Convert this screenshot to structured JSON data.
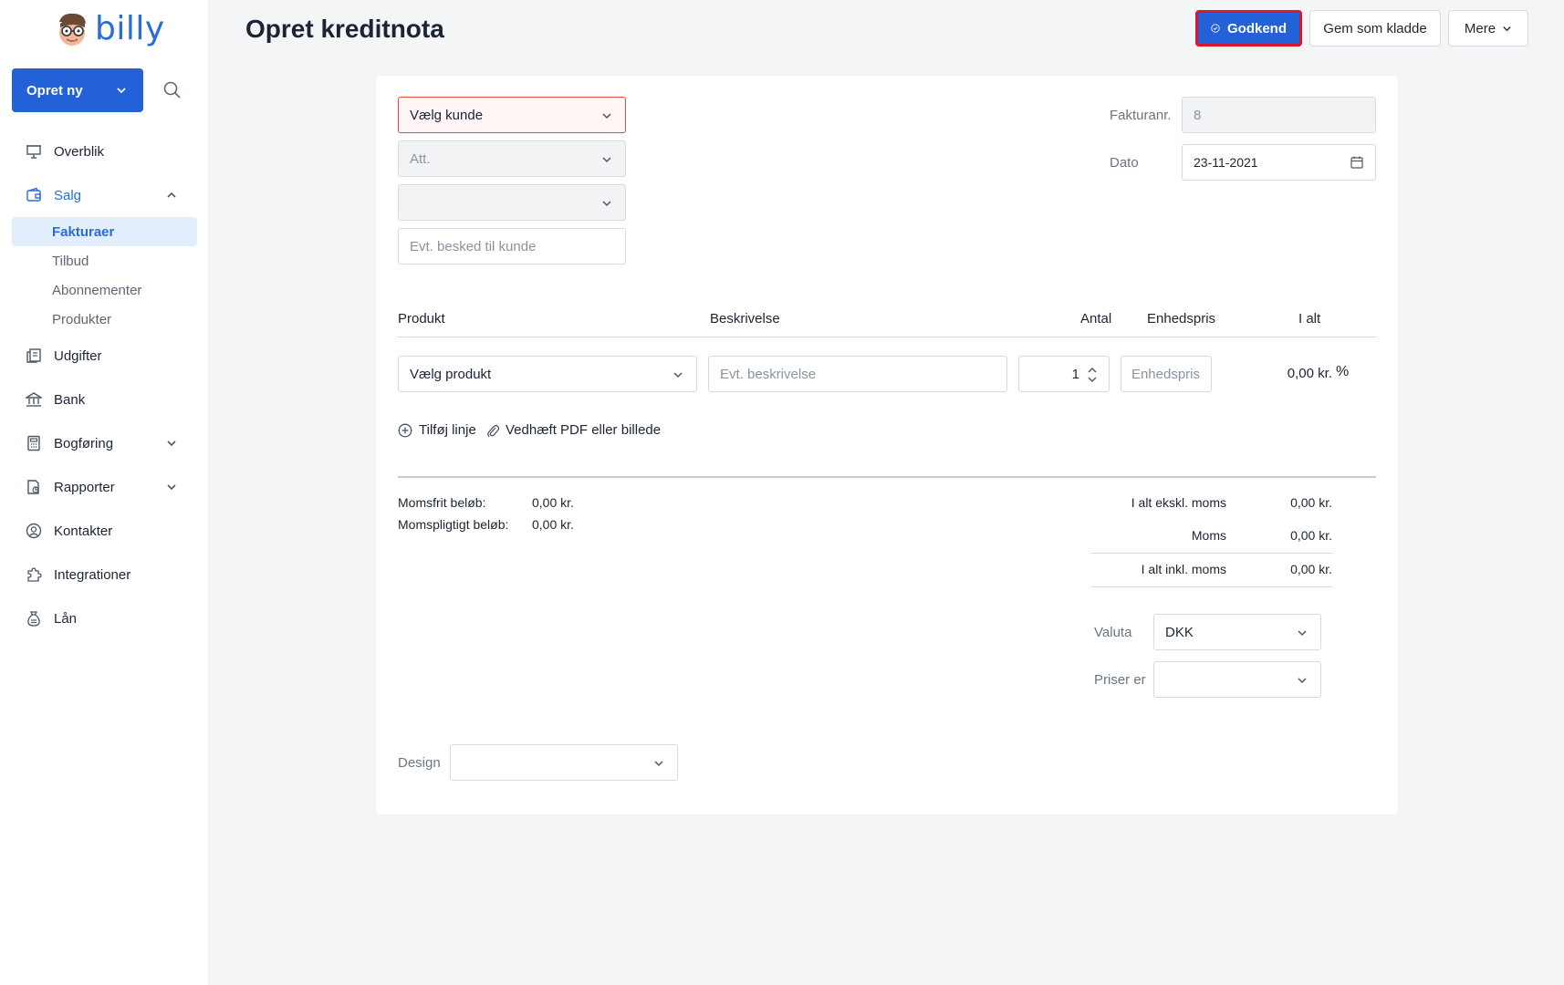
{
  "app": {
    "logo_text": "billy",
    "page_title": "Opret kreditnota"
  },
  "sidebar": {
    "create_label": "Opret ny",
    "items": [
      {
        "label": "Overblik",
        "icon": "presentation-board-icon"
      },
      {
        "label": "Salg",
        "icon": "wallet-icon",
        "expanded": true
      },
      {
        "label": "Udgifter",
        "icon": "receipts-icon"
      },
      {
        "label": "Bank",
        "icon": "bank-icon"
      },
      {
        "label": "Bogføring",
        "icon": "calculator-icon"
      },
      {
        "label": "Rapporter",
        "icon": "report-icon"
      },
      {
        "label": "Kontakter",
        "icon": "user-circle-icon"
      },
      {
        "label": "Integrationer",
        "icon": "puzzle-icon"
      },
      {
        "label": "Lån",
        "icon": "money-bag-icon"
      }
    ],
    "sales_sub": [
      "Fakturaer",
      "Tilbud",
      "Abonnementer",
      "Produkter"
    ]
  },
  "header": {
    "approve": "Godkend",
    "save_draft": "Gem som kladde",
    "more": "Mere"
  },
  "customer": {
    "select": "Vælg kunde",
    "attention": "Att.",
    "message_placeholder": "Evt. besked til kunde"
  },
  "meta": {
    "invoice_no_label": "Fakturanr.",
    "invoice_no": "8",
    "date_label": "Dato",
    "date": "23-11-2021"
  },
  "lines": {
    "headers": {
      "product": "Produkt",
      "description": "Beskrivelse",
      "quantity": "Antal",
      "unit_price": "Enhedspris",
      "total": "I alt"
    },
    "row": {
      "product": "Vælg produkt",
      "description_placeholder": "Evt. beskrivelse",
      "quantity": "1",
      "unit_price_placeholder": "Enhedspris",
      "total": "0,00 kr.",
      "percent": "%"
    },
    "add_line": "Tilføj linje",
    "attach": "Vedhæft PDF eller billede"
  },
  "totals": {
    "vat_free_label": "Momsfrit beløb:",
    "vat_free": "0,00 kr.",
    "vat_liable_label": "Momspligtigt beløb:",
    "vat_liable": "0,00 kr.",
    "excl_label": "I alt ekskl. moms",
    "excl": "0,00 kr.",
    "vat_label": "Moms",
    "vat": "0,00 kr.",
    "incl_label": "I alt inkl. moms",
    "incl": "0,00 kr."
  },
  "options": {
    "currency_label": "Valuta",
    "currency": "DKK",
    "prices_label": "Priser er",
    "design_label": "Design"
  },
  "colors": {
    "accent": "#2361d9",
    "highlight": "#d7182a",
    "error": "#e24d3b"
  }
}
